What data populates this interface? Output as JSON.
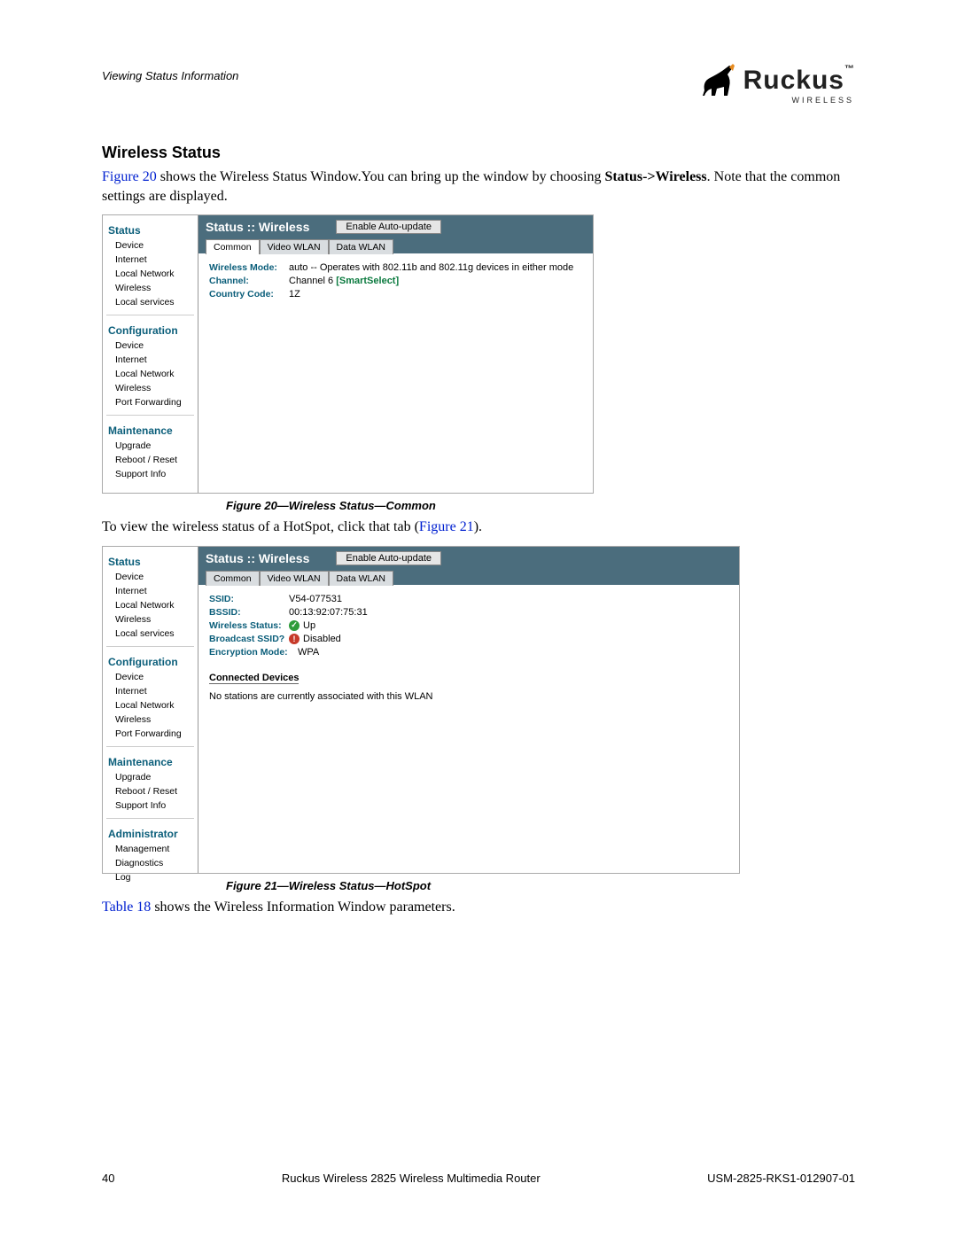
{
  "header": {
    "section_label": "Viewing Status Information",
    "logo_text": "Ruckus",
    "logo_sub": "WIRELESS",
    "logo_tm": "™"
  },
  "title": "Wireless Status",
  "para1_link": "Figure 20",
  "para1_a": " shows the Wireless Status Window.You can bring up the window by choosing ",
  "para1_bold": "Status->Wireless",
  "para1_b": ". Note that the common settings are displayed.",
  "fig20": {
    "caption": "Figure 20—Wireless Status—Common",
    "sidebar": {
      "status": {
        "title": "Status",
        "items": [
          "Device",
          "Internet",
          "Local Network",
          "Wireless",
          "Local services"
        ]
      },
      "config": {
        "title": "Configuration",
        "items": [
          "Device",
          "Internet",
          "Local Network",
          "Wireless",
          "Port Forwarding"
        ]
      },
      "maint": {
        "title": "Maintenance",
        "items": [
          "Upgrade",
          "Reboot / Reset",
          "Support Info"
        ]
      }
    },
    "titlebar": {
      "title": "Status :: Wireless",
      "button": "Enable Auto-update"
    },
    "tabs": [
      "Common",
      "Video WLAN",
      "Data WLAN"
    ],
    "active_tab": 0,
    "rows": [
      {
        "key": "Wireless Mode:",
        "val": "auto -- Operates with 802.11b and 802.11g devices in either mode"
      },
      {
        "key": "Channel:",
        "val_a": "Channel 6 ",
        "val_b": "[SmartSelect]"
      },
      {
        "key": "Country Code:",
        "val": "1Z"
      }
    ]
  },
  "para2_a": "To view the wireless status of a HotSpot, click that tab (",
  "para2_link": "Figure 21",
  "para2_b": ").",
  "fig21": {
    "caption": "Figure 21—Wireless Status—HotSpot",
    "sidebar": {
      "status": {
        "title": "Status",
        "items": [
          "Device",
          "Internet",
          "Local Network",
          "Wireless",
          "Local services"
        ]
      },
      "config": {
        "title": "Configuration",
        "items": [
          "Device",
          "Internet",
          "Local Network",
          "Wireless",
          "Port Forwarding"
        ]
      },
      "maint": {
        "title": "Maintenance",
        "items": [
          "Upgrade",
          "Reboot / Reset",
          "Support Info"
        ]
      },
      "admin": {
        "title": "Administrator",
        "items": [
          "Management",
          "Diagnostics",
          "Log"
        ]
      }
    },
    "titlebar": {
      "title": "Status :: Wireless",
      "button": "Enable Auto-update"
    },
    "tabs": [
      "Common",
      "Video WLAN",
      "Data WLAN"
    ],
    "rows": {
      "ssid": {
        "k": "SSID:",
        "v": "V54-077531"
      },
      "bssid": {
        "k": "BSSID:",
        "v": "00:13:92:07:75:31"
      },
      "wstatus": {
        "k": "Wireless Status:",
        "v": "Up"
      },
      "broadcast": {
        "k": "Broadcast SSID?",
        "v": "Disabled"
      },
      "enc": {
        "k": "Encryption Mode:",
        "v": "WPA"
      }
    },
    "connected_hdr": "Connected Devices",
    "connected_msg": "No stations are currently associated with this WLAN"
  },
  "para3_link": "Table 18",
  "para3_a": " shows the Wireless Information Window parameters.",
  "footer": {
    "page": "40",
    "center": "Ruckus Wireless 2825 Wireless Multimedia Router",
    "right": "USM-2825-RKS1-012907-01"
  }
}
